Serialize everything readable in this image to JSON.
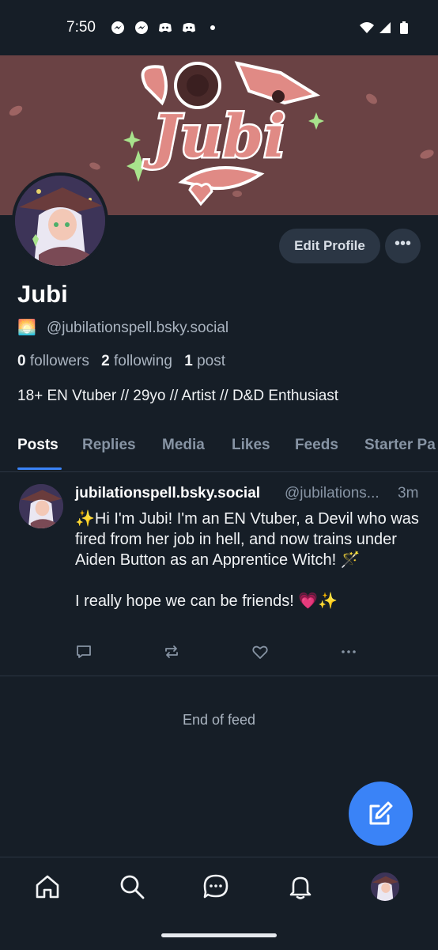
{
  "status_bar": {
    "time": "7:50",
    "icons": [
      "messenger-icon",
      "messenger-icon",
      "discord-icon",
      "discord-icon",
      "dot-icon",
      "wifi-icon",
      "signal-icon",
      "battery-icon"
    ]
  },
  "banner": {
    "logo_text": "Jubi",
    "background_color": "#6a4244",
    "accent_color": "#e08a85"
  },
  "profile": {
    "display_name": "Jubi",
    "handle_emoji": "🌅",
    "handle": "@jubilationspell.bsky.social",
    "followers_count": "0",
    "followers_label": "followers",
    "following_count": "2",
    "following_label": "following",
    "posts_count": "1",
    "posts_label": "post",
    "bio": "18+ EN Vtuber // 29yo // Artist // D&D Enthusiast",
    "edit_profile_label": "Edit Profile",
    "more_label": "•••"
  },
  "tabs": [
    {
      "label": "Posts",
      "active": true
    },
    {
      "label": "Replies"
    },
    {
      "label": "Media"
    },
    {
      "label": "Likes"
    },
    {
      "label": "Feeds"
    },
    {
      "label": "Starter Pa"
    }
  ],
  "post": {
    "author": "jubilationspell.bsky.social",
    "handle": "@jubilations...",
    "time": "3m",
    "text": "✨Hi I'm Jubi! I'm an EN Vtuber, a Devil who was fired from her job in hell, and now trains under Aiden Button as an Apprentice Witch! 🪄\n\nI really hope we can be friends! 💗✨",
    "actions": [
      "reply-icon",
      "repost-icon",
      "like-icon",
      "more-icon"
    ]
  },
  "end_of_feed": "End of feed",
  "bottom_nav": [
    "home-icon",
    "search-icon",
    "chat-icon",
    "bell-icon",
    "profile-avatar"
  ],
  "colors": {
    "accent": "#3a83f7",
    "background": "#161e27",
    "button": "#2b3644"
  }
}
